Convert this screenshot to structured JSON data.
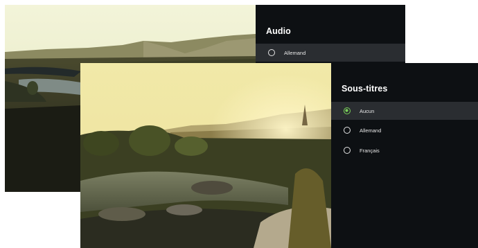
{
  "audio_panel": {
    "title": "Audio",
    "options": [
      {
        "label": "Allemand",
        "selected": false
      }
    ]
  },
  "subtitles_panel": {
    "title": "Sous-titres",
    "options": [
      {
        "label": "Aucun",
        "selected": true
      },
      {
        "label": "Allemand",
        "selected": false
      },
      {
        "label": "Français",
        "selected": false
      }
    ]
  },
  "colors": {
    "panel_bg": "#0d1013",
    "selected_row_bg": "#2a2d31",
    "accent": "#7bd25a"
  }
}
